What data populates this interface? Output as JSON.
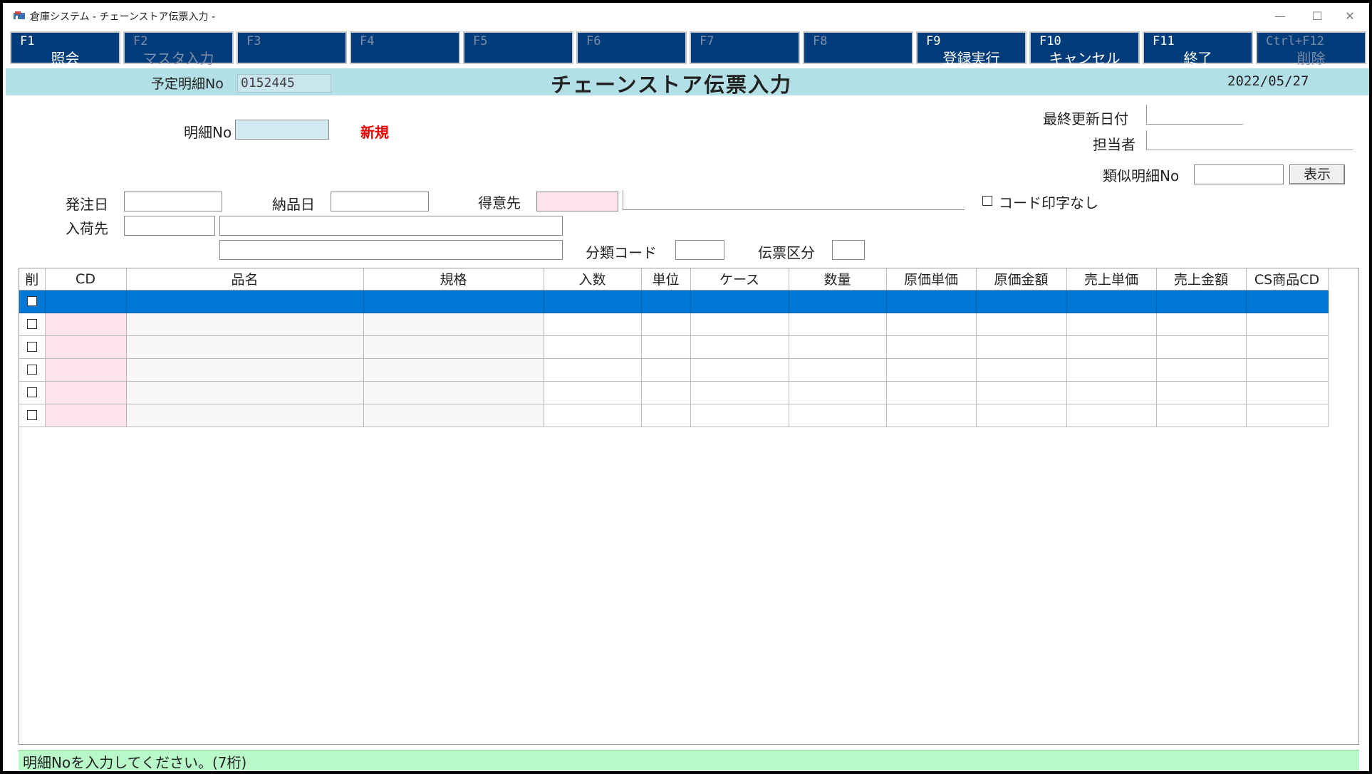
{
  "window": {
    "title": "倉庫システム - チェーンストア伝票入力 -",
    "controls": [
      "—",
      "☐",
      "✕"
    ]
  },
  "fkeys": [
    {
      "key": "F1",
      "label": "照会",
      "enabled": true
    },
    {
      "key": "F2",
      "label": "マスタ入力",
      "enabled": false
    },
    {
      "key": "F3",
      "label": "",
      "enabled": false
    },
    {
      "key": "F4",
      "label": "",
      "enabled": false
    },
    {
      "key": "F5",
      "label": "",
      "enabled": false
    },
    {
      "key": "F6",
      "label": "",
      "enabled": false
    },
    {
      "key": "F7",
      "label": "",
      "enabled": false
    },
    {
      "key": "F8",
      "label": "",
      "enabled": false
    },
    {
      "key": "F9",
      "label": "登録実行",
      "enabled": true
    },
    {
      "key": "F10",
      "label": "キャンセル",
      "enabled": true
    },
    {
      "key": "F11",
      "label": "終了",
      "enabled": true
    },
    {
      "key": "Ctrl+F12",
      "label": "削除",
      "enabled": false
    }
  ],
  "header": {
    "plan_no_label": "予定明細No",
    "plan_no_value": "0152445",
    "title": "チェーンストア伝票入力",
    "date": "2022/05/27"
  },
  "form": {
    "detail_no_label": "明細No",
    "detail_no_value": "",
    "status_new": "新規",
    "last_update_label": "最終更新日付",
    "person_label": "担当者",
    "similar_no_label": "類似明細No",
    "show_button": "表示",
    "order_date_label": "発注日",
    "delivery_date_label": "納品日",
    "customer_label": "得意先",
    "no_code_print_label": "コード印字なし",
    "receiver_label": "入荷先",
    "category_code_label": "分類コード",
    "slip_type_label": "伝票区分"
  },
  "grid": {
    "columns": [
      "削",
      "CD",
      "品名",
      "規格",
      "入数",
      "単位",
      "ケース",
      "数量",
      "原価単価",
      "原価金額",
      "売上単価",
      "売上金額",
      "CS商品CD"
    ],
    "row_count": 6,
    "selected_row": 0
  },
  "status_bar": {
    "message": "明細Noを入力してください。(7桁)"
  },
  "colors": {
    "fkey_bg": "#003b7a",
    "header_bg": "#b3e0e6",
    "selected_row": "#0077d7",
    "status_bg": "#b9f8c8",
    "required_field": "#fde4ea",
    "new_label": "#e60000"
  }
}
